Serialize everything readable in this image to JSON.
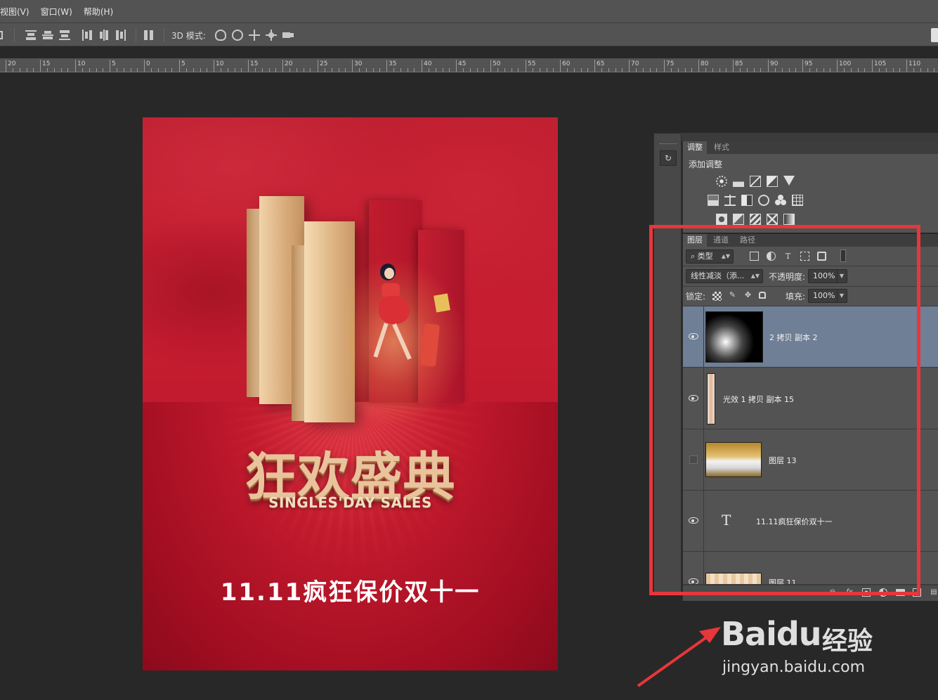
{
  "menu": {
    "items": [
      "视图(V)",
      "窗口(W)",
      "帮助(H)"
    ]
  },
  "options_bar": {
    "mode_3d_label": "3D 模式:"
  },
  "ruler": {
    "labels": [
      "20",
      "15",
      "10",
      "5",
      "0",
      "5",
      "10",
      "15",
      "20",
      "25",
      "30",
      "35",
      "40",
      "45",
      "50",
      "55",
      "60",
      "65",
      "70",
      "75",
      "80",
      "85",
      "90",
      "95",
      "100",
      "105",
      "110"
    ]
  },
  "poster": {
    "title": "狂欢盛典",
    "subtitle": "SINGLES'DAY SALES",
    "slogan": "11.11疯狂保价双十一",
    "colors": {
      "background": "#c21a2d",
      "gold": "#e9c39b"
    }
  },
  "adjustments_panel": {
    "tabs": [
      "调整",
      "样式"
    ],
    "active_tab": "调整",
    "add_label": "添加调整",
    "icons": [
      "brightness-icon",
      "levels-icon",
      "curves-icon",
      "exposure-icon",
      "vibrance-icon",
      "hue-saturation-icon",
      "color-balance-icon",
      "black-white-icon",
      "photo-filter-icon",
      "channel-mixer-icon",
      "color-lookup-icon",
      "invert-icon",
      "posterize-icon",
      "threshold-icon",
      "selective-color-icon",
      "gradient-map-icon"
    ]
  },
  "layers_panel": {
    "tabs": [
      "图层",
      "通道",
      "路径"
    ],
    "active_tab": "图层",
    "filter_kind": "类型",
    "blend_mode": "线性减淡（添...",
    "opacity_label": "不透明度:",
    "opacity_value": "100%",
    "lock_label": "锁定:",
    "fill_label": "填充:",
    "fill_value": "100%",
    "layers": [
      {
        "name": "2 拷贝 副本 2",
        "visible": true,
        "selected": true,
        "kind": "pixel"
      },
      {
        "name": "光效 1 拷贝 副本 15",
        "visible": true,
        "selected": false,
        "kind": "pixel"
      },
      {
        "name": "图层 13",
        "visible": false,
        "selected": false,
        "kind": "pixel"
      },
      {
        "name": "11.11疯狂保价双十一",
        "visible": true,
        "selected": false,
        "kind": "text"
      },
      {
        "name": "图层 11",
        "visible": true,
        "selected": false,
        "kind": "pixel"
      }
    ]
  },
  "watermark": {
    "brand": "Baidu",
    "suffix": "经验",
    "url": "jingyan.baidu.com"
  },
  "annotation": {
    "color": "#e8363a"
  }
}
